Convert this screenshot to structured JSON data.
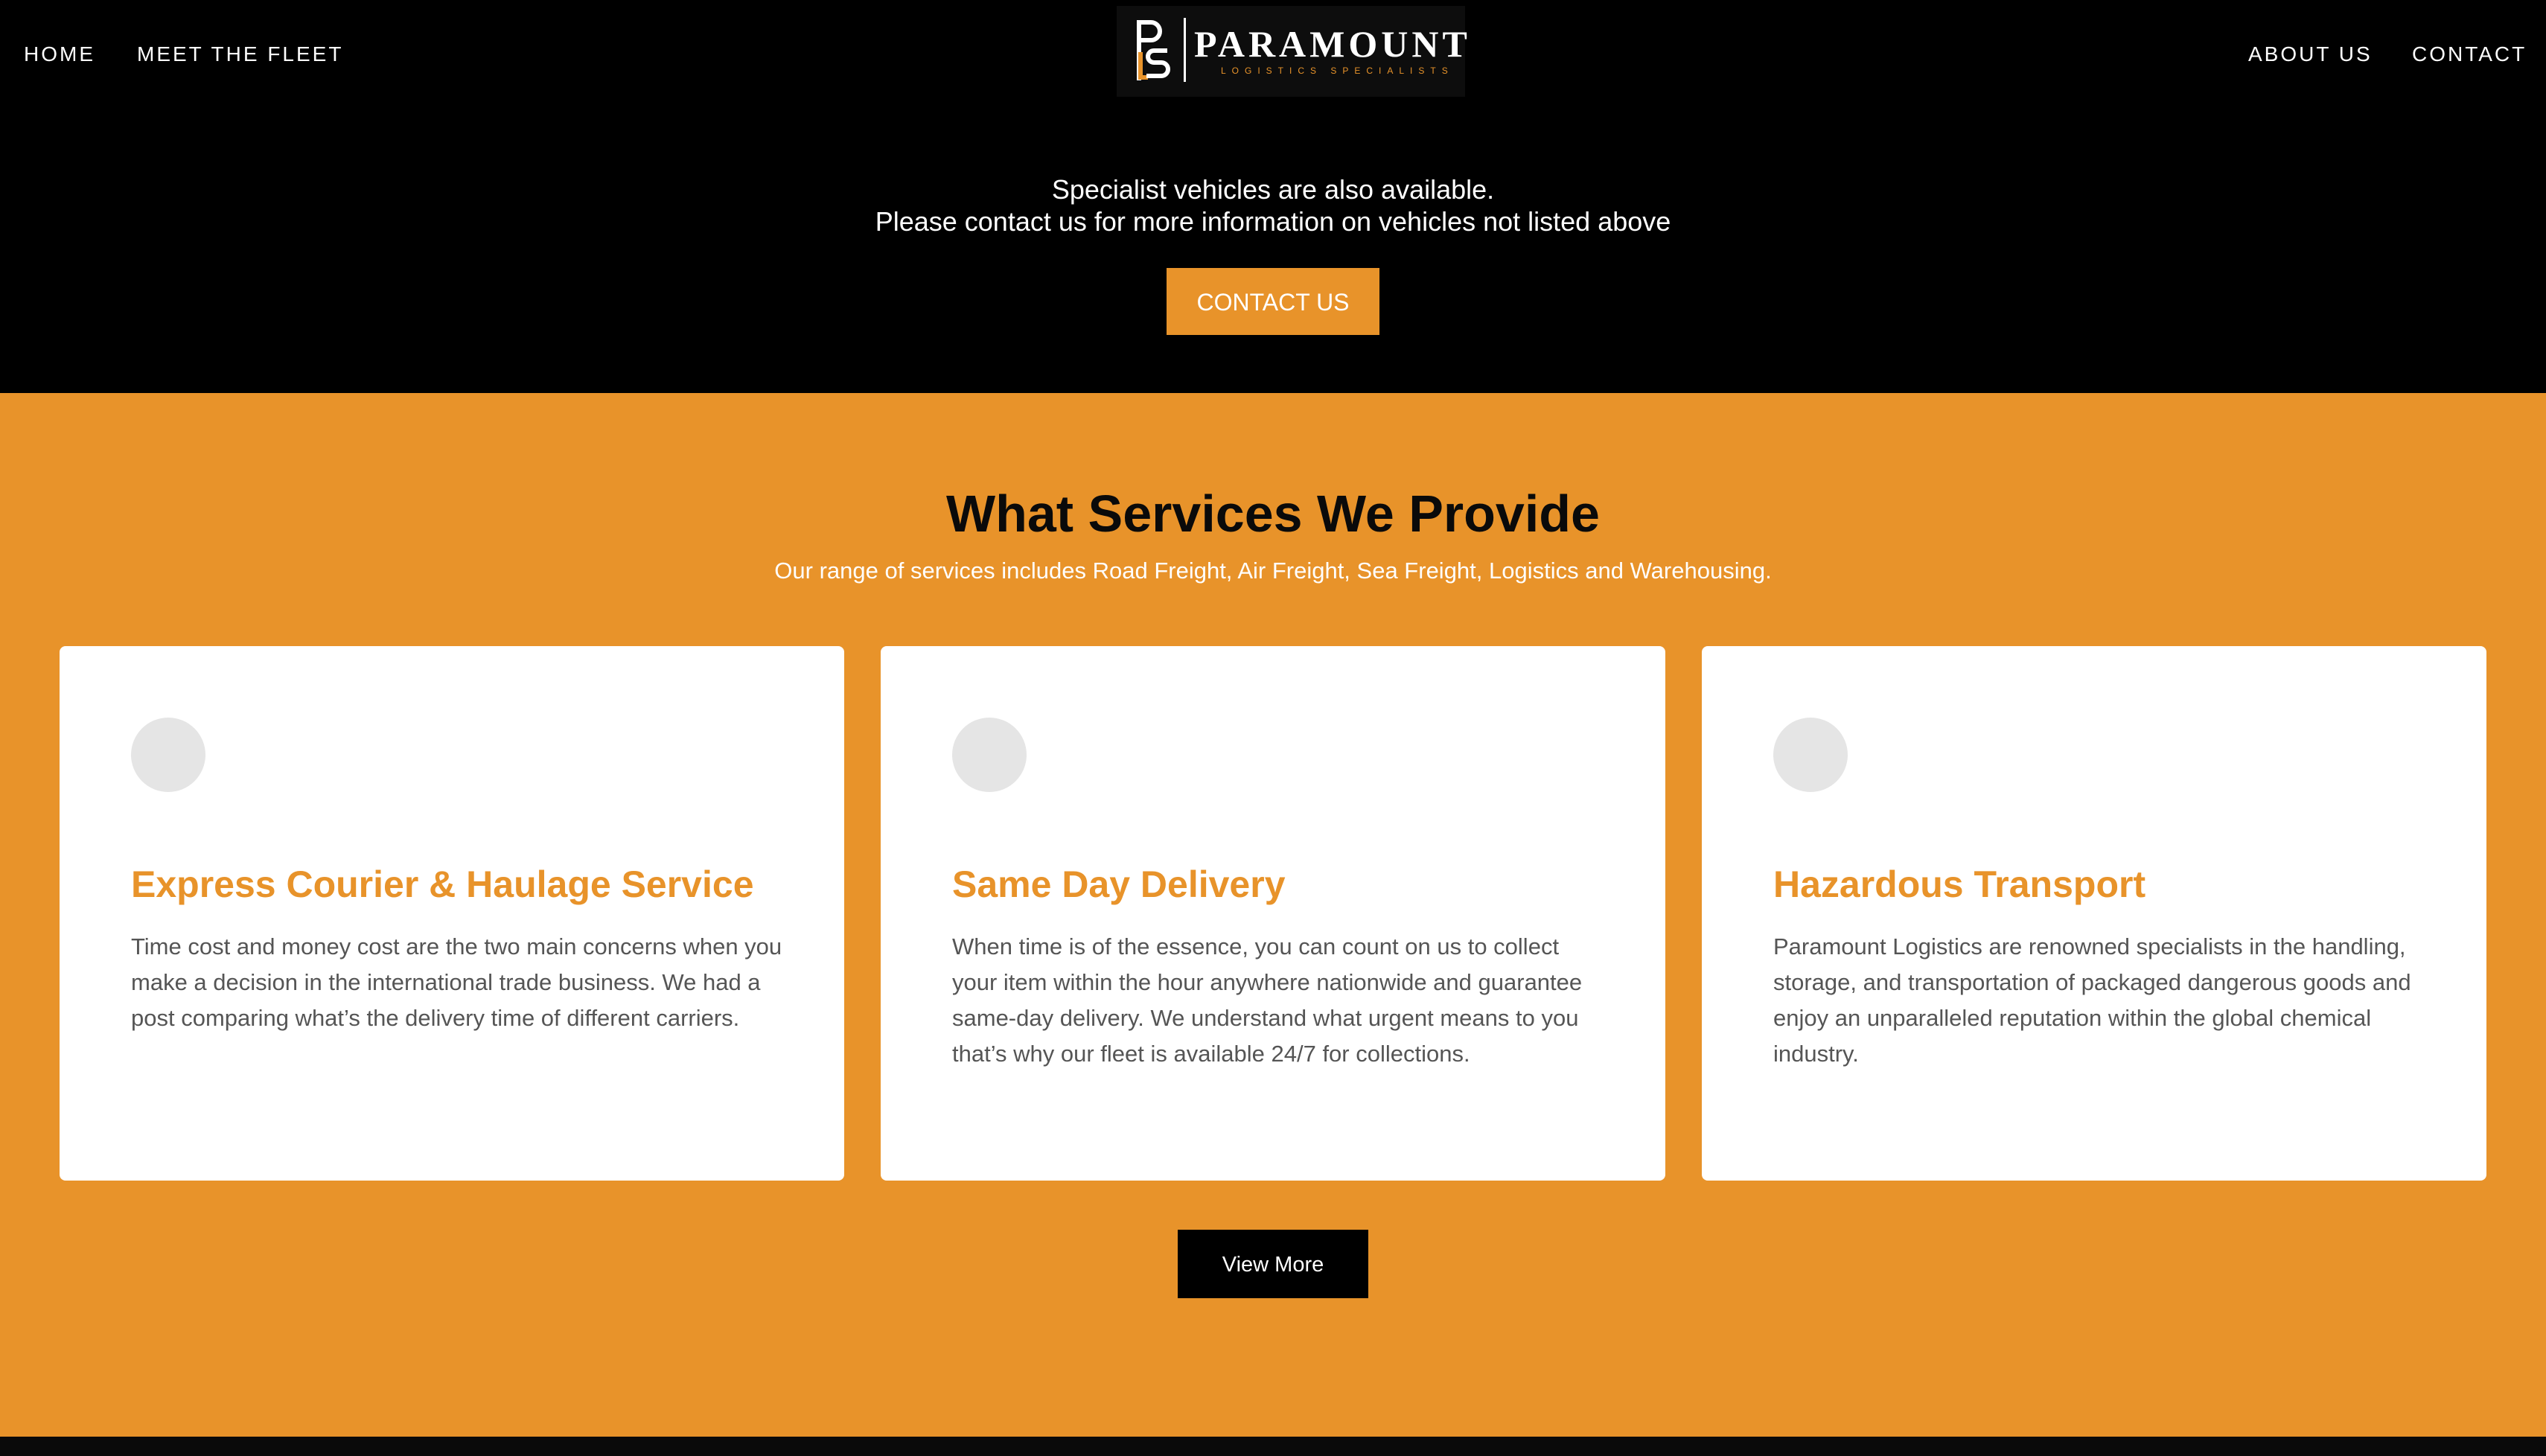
{
  "nav": {
    "home": "HOME",
    "fleet": "MEET THE FLEET",
    "about": "ABOUT US",
    "contact": "CONTACT"
  },
  "logo": {
    "name": "PARAMOUNT",
    "tagline": "LOGISTICS SPECIALISTS",
    "icon": "pls-monogram-icon"
  },
  "specialist": {
    "line1": "Specialist vehicles are also available.",
    "line2": "Please contact us for more information on vehicles not listed above",
    "button": "CONTACT US"
  },
  "services": {
    "title": "What Services We Provide",
    "subtitle": "Our range of services includes Road Freight, Air Freight, Sea Freight, Logistics and Warehousing.",
    "cards": [
      {
        "icon": "service-icon-placeholder",
        "title": "Express Courier & Haulage Service",
        "text": "Time cost and money cost are the two main concerns when you make a decision in the international trade business. We had a post comparing what’s the delivery time of different carriers."
      },
      {
        "icon": "service-icon-placeholder",
        "title": "Same Day Delivery",
        "text": "When time is of the essence, you can count on us to collect your item within the hour anywhere nationwide and guarantee same-day delivery. We understand what urgent means to you that’s why our fleet is available 24/7 for collections."
      },
      {
        "icon": "service-icon-placeholder",
        "title": "Hazardous Transport",
        "text": "Paramount Logistics are renowned specialists in the handling, storage, and transportation of packaged dangerous goods and enjoy an unparalleled reputation within the global chemical industry."
      }
    ],
    "view_more": "View More"
  },
  "colors": {
    "accent": "#e8932a",
    "background": "#000000",
    "card": "#ffffff",
    "card_text": "#555555",
    "icon_circle": "#e5e5e5"
  }
}
